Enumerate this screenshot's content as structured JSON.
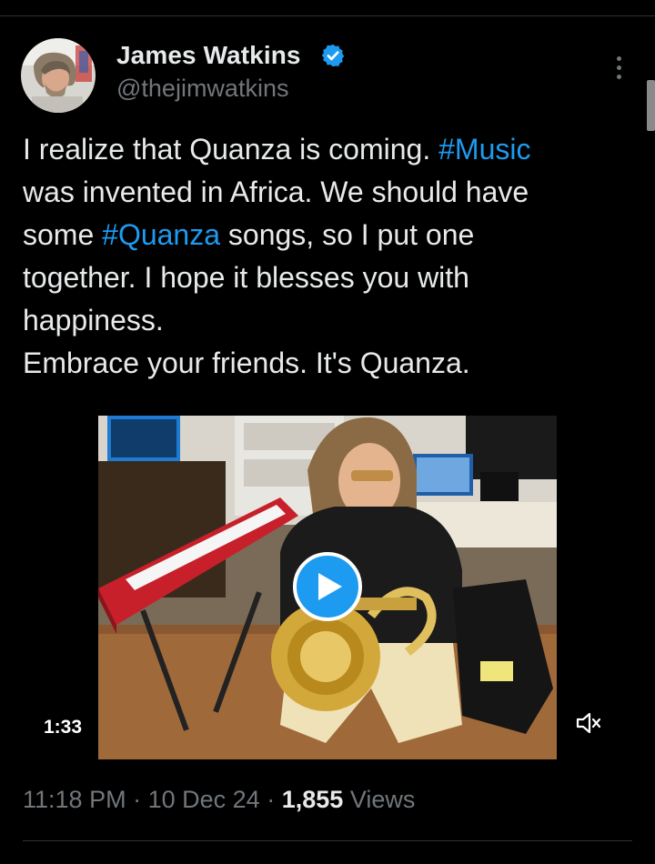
{
  "author": {
    "name": "James Watkins",
    "handle": "@thejimwatkins",
    "verified": true,
    "verified_color": "#1d9bf0",
    "avatar_icon": "profile-photo"
  },
  "tweet": {
    "lines": [
      [
        {
          "text": "I realize that Quanza is coming. "
        },
        {
          "text": "#Music",
          "hashtag": true
        }
      ],
      [
        {
          "text": "was invented in Africa. We should have"
        }
      ],
      [
        {
          "text": "some "
        },
        {
          "text": "#Quanza",
          "hashtag": true
        },
        {
          "text": " songs, so I put one"
        }
      ],
      [
        {
          "text": "together. I hope it blesses you with"
        }
      ],
      [
        {
          "text": "happiness."
        }
      ],
      [
        {
          "text": "Embrace your friends. It's Quanza."
        }
      ]
    ]
  },
  "video": {
    "duration": "1:33",
    "play_icon": "play-icon",
    "mute_icon": "muted-speaker-icon"
  },
  "meta": {
    "time": "11:18 PM",
    "separator": "·",
    "date": "10 Dec 24",
    "views_count": "1,855",
    "views_label": "Views"
  },
  "colors": {
    "background": "#000000",
    "text": "#e7e9ea",
    "secondary_text": "#71767b",
    "accent": "#1d9bf0",
    "divider": "#2f3336"
  }
}
